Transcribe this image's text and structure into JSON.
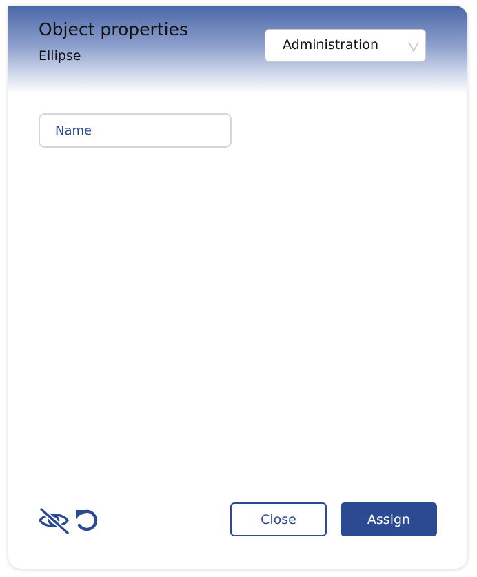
{
  "header": {
    "title": "Object properties",
    "subtitle": "Ellipse"
  },
  "role_select": {
    "selected": "Administration"
  },
  "form": {
    "name_placeholder": "Name",
    "name_value": ""
  },
  "footer": {
    "close_label": "Close",
    "assign_label": "Assign"
  },
  "icons": {
    "visibility": "eye-slash-icon",
    "reset": "undo-icon",
    "dropdown": "chevron-down-icon"
  },
  "colors": {
    "accent": "#2c4a92",
    "header_top": "#4a67a8"
  }
}
